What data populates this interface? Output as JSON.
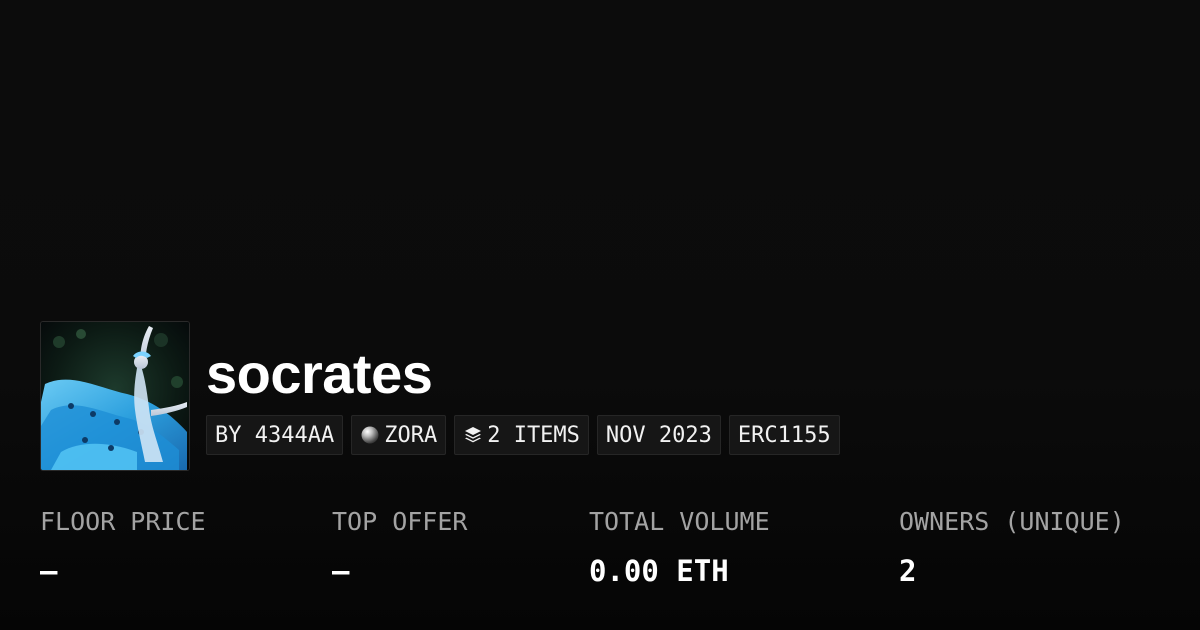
{
  "collection": {
    "name": "socrates",
    "thumbnail_icon": "collection-artwork-image"
  },
  "badges": {
    "creator": "BY 4344AA",
    "chain": {
      "label": "ZORA",
      "icon": "zora-orb-icon"
    },
    "items": {
      "label": "2 ITEMS",
      "icon": "layers-icon"
    },
    "date": "NOV 2023",
    "standard": "ERC1155"
  },
  "stats": [
    {
      "label": "FLOOR PRICE",
      "value": "–"
    },
    {
      "label": "TOP OFFER",
      "value": "–"
    },
    {
      "label": "TOTAL VOLUME",
      "value": "0.00 ETH"
    },
    {
      "label": "OWNERS (UNIQUE)",
      "value": "2"
    }
  ],
  "colors": {
    "background": "#0a0a0a",
    "badge_background": "#161616",
    "label_gray": "#a3a3a3",
    "text_white": "#ffffff"
  }
}
